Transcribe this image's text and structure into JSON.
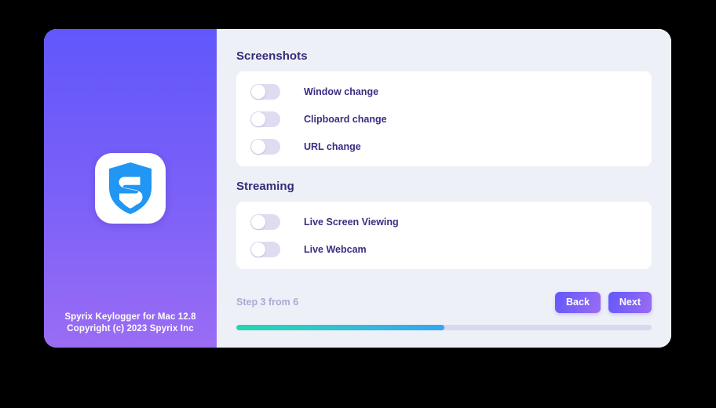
{
  "app": {
    "logo_icon": "shield-s-logo-icon",
    "logo_color": "#2196f3",
    "footer_line1": "Spyrix Keylogger for Mac 12.8",
    "footer_line2": "Copyright (c) 2023 Spyrix Inc",
    "sidebar_gradient_start": "#6157fb",
    "sidebar_gradient_end": "#9a6cf4"
  },
  "sections": [
    {
      "heading": "Screenshots",
      "options": [
        {
          "label": "Window change",
          "enabled": false
        },
        {
          "label": "Clipboard change",
          "enabled": false
        },
        {
          "label": "URL change",
          "enabled": false
        }
      ]
    },
    {
      "heading": "Streaming",
      "options": [
        {
          "label": "Live Screen Viewing",
          "enabled": false
        },
        {
          "label": "Live Webcam",
          "enabled": false
        }
      ]
    }
  ],
  "footer": {
    "step_label": "Step 3 from 6",
    "current_step": 3,
    "total_steps": 6,
    "back_label": "Back",
    "next_label": "Next",
    "progress_percent": "50%",
    "progress_gradient_start": "#23d6b0",
    "progress_gradient_end": "#34a6f4",
    "button_gradient_start": "#6258fb",
    "button_gradient_end": "#9a6cf4"
  }
}
